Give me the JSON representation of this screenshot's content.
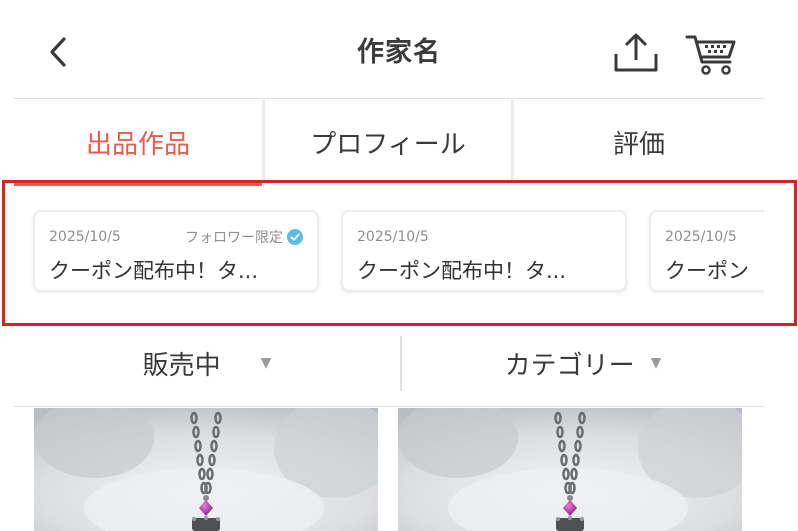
{
  "header": {
    "title": "作家名",
    "back_icon": "chevron-left-icon",
    "share_icon": "share-icon",
    "cart_icon": "cart-icon"
  },
  "tabs": [
    {
      "label": "出品作品",
      "active": true
    },
    {
      "label": "プロフィール",
      "active": false
    },
    {
      "label": "評価",
      "active": false
    }
  ],
  "coupons": [
    {
      "date": "2025/10/5",
      "badge": "フォロワー限定",
      "title": "クーポン配布中！タ..."
    },
    {
      "date": "2025/10/5",
      "badge": "",
      "title": "クーポン配布中！タ..."
    },
    {
      "date": "2025/10/5",
      "badge": "",
      "title": "クーポン"
    }
  ],
  "filters": [
    {
      "label": "販売中"
    },
    {
      "label": "カテゴリー"
    }
  ],
  "colors": {
    "accent": "#ea5b4f",
    "highlight_frame": "#d9231e",
    "verified_badge": "#5bbbe0"
  }
}
